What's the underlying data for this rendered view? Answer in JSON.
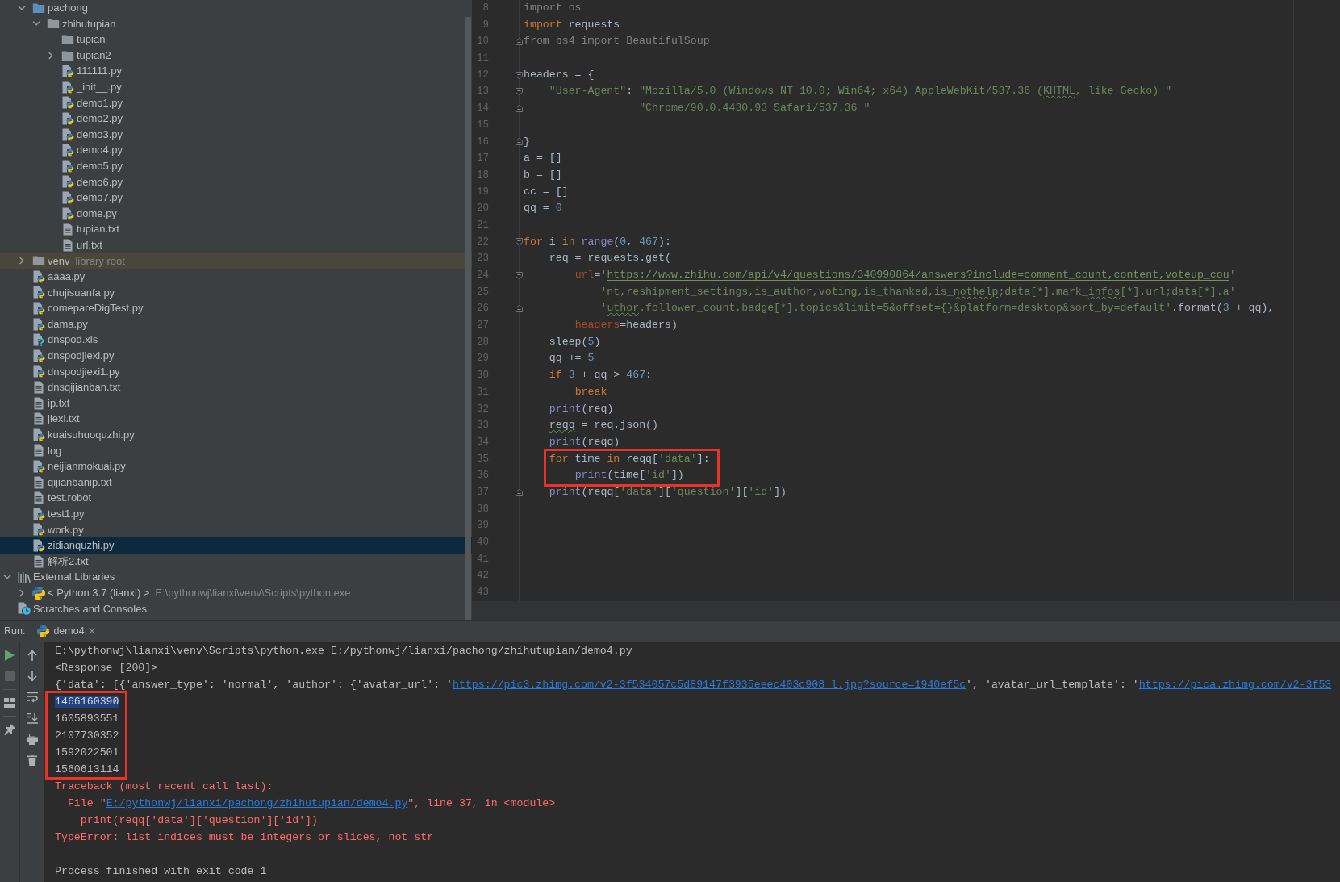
{
  "project_tree": {
    "nodes": [
      {
        "children": [
          {
            "label": "pachong",
            "kind": "package",
            "expanded": true,
            "selected": false,
            "children": [
              {
                "label": "zhihutupian",
                "kind": "folder",
                "expanded": true,
                "selected": false,
                "children": [
                  {
                    "label": "tupian",
                    "kind": "folder",
                    "selected": false
                  },
                  {
                    "label": "tupian2",
                    "kind": "folder",
                    "expanded": false,
                    "selected": false
                  },
                  {
                    "label": "111111.py",
                    "kind": "python",
                    "selected": false
                  },
                  {
                    "label": "_init__.py",
                    "kind": "python",
                    "selected": false
                  },
                  {
                    "label": "demo1.py",
                    "kind": "python",
                    "selected": false
                  },
                  {
                    "label": "demo2.py",
                    "kind": "python",
                    "selected": false
                  },
                  {
                    "label": "demo3.py",
                    "kind": "python",
                    "selected": false
                  },
                  {
                    "label": "demo4.py",
                    "kind": "python",
                    "selected": false
                  },
                  {
                    "label": "demo5.py",
                    "kind": "python",
                    "selected": false
                  },
                  {
                    "label": "demo6.py",
                    "kind": "python",
                    "selected": false
                  },
                  {
                    "label": "demo7.py",
                    "kind": "python",
                    "selected": false
                  },
                  {
                    "label": "dome.py",
                    "kind": "python",
                    "selected": false
                  },
                  {
                    "label": "tupian.txt",
                    "kind": "text",
                    "selected": false
                  },
                  {
                    "label": "url.txt",
                    "kind": "text",
                    "selected": false
                  }
                ]
              }
            ]
          },
          {
            "label": "venv",
            "kind": "folder",
            "expanded": false,
            "detail": "library root",
            "color": "#4a4639",
            "selected": false
          },
          {
            "label": "aaaa.py",
            "kind": "python",
            "selected": false
          },
          {
            "label": "chujisuanfa.py",
            "kind": "python",
            "selected": false
          },
          {
            "label": "comepareDigTest.py",
            "kind": "python",
            "selected": false
          },
          {
            "label": "dama.py",
            "kind": "python",
            "selected": false
          },
          {
            "label": "dnspod.xls",
            "kind": "unknown",
            "selected": false
          },
          {
            "label": "dnspodjiexi.py",
            "kind": "python",
            "selected": false
          },
          {
            "label": "dnspodjiexi1.py",
            "kind": "python",
            "selected": false
          },
          {
            "label": "dnsqijianban.txt",
            "kind": "text",
            "selected": false
          },
          {
            "label": "ip.txt",
            "kind": "text",
            "selected": false
          },
          {
            "label": "jiexi.txt",
            "kind": "text",
            "selected": false
          },
          {
            "label": "kuaisuhuoquzhi.py",
            "kind": "python",
            "selected": false
          },
          {
            "label": "log",
            "kind": "text",
            "selected": false
          },
          {
            "label": "neijianmokuai.py",
            "kind": "python",
            "selected": false
          },
          {
            "label": "qijianbanip.txt",
            "kind": "text",
            "selected": false
          },
          {
            "label": "test.robot",
            "kind": "text",
            "selected": false
          },
          {
            "label": "test1.py",
            "kind": "python",
            "selected": false
          },
          {
            "label": "work.py",
            "kind": "python",
            "selected": false
          },
          {
            "label": "zidianquzhi.py",
            "kind": "python",
            "selected": true
          },
          {
            "label": "解析2.txt",
            "kind": "text",
            "selected": false
          }
        ]
      },
      {
        "label": "External Libraries",
        "kind": "libraries",
        "expanded": true,
        "selected": false,
        "children": [
          {
            "label": "< Python 3.7 (lianxi) >",
            "kind": "interpreter",
            "expanded": false,
            "detail": "E:\\pythonwj\\lianxi\\venv\\Scripts\\python.exe",
            "selected": false
          }
        ]
      },
      {
        "label": "Scratches and Consoles",
        "kind": "scratches",
        "selected": false
      }
    ]
  },
  "editor": {
    "lines": [
      {
        "number": "8",
        "tokens": [
          {
            "kind": "unused",
            "text": "import os"
          }
        ],
        "framed": false
      },
      {
        "number": "9",
        "tokens": [
          {
            "kind": "keyword",
            "text": "import"
          },
          {
            "kind": "plain",
            "text": " requests"
          }
        ],
        "framed": false
      },
      {
        "number": "10",
        "fold": {
          "kind": "end"
        },
        "tokens": [
          {
            "kind": "unused",
            "text": "from bs4 import BeautifulSoup"
          }
        ],
        "framed": false
      },
      {
        "number": "11",
        "framed": false
      },
      {
        "number": "12",
        "fold": {
          "kind": "start"
        },
        "tokens": [
          {
            "kind": "plain",
            "text": "headers = {"
          }
        ],
        "framed": false
      },
      {
        "number": "13",
        "fold": {
          "kind": "start"
        },
        "tokens": [
          {
            "kind": "string",
            "text": "    \"User-Agent\""
          },
          {
            "kind": "plain",
            "text": ": "
          },
          {
            "kind": "string",
            "text": "\"Mozilla/5.0 (Windows NT 10.0; Win64; x64) AppleWebKit/537.36 ("
          },
          {
            "kind": "string-typo",
            "text": "KHTML"
          },
          {
            "kind": "string",
            "text": ", like Gecko) \""
          }
        ],
        "framed": false
      },
      {
        "number": "14",
        "fold": {
          "kind": "end"
        },
        "tokens": [
          {
            "kind": "string",
            "text": "                  \"Chrome/90.0.4430.93 Safari/537.36 \""
          }
        ],
        "framed": false
      },
      {
        "number": "15",
        "framed": false
      },
      {
        "number": "16",
        "fold": {
          "kind": "end"
        },
        "tokens": [
          {
            "kind": "plain",
            "text": "}"
          }
        ],
        "framed": false
      },
      {
        "number": "17",
        "tokens": [
          {
            "kind": "plain",
            "text": "a = []"
          }
        ],
        "framed": false
      },
      {
        "number": "18",
        "tokens": [
          {
            "kind": "plain",
            "text": "b = []"
          }
        ],
        "framed": false
      },
      {
        "number": "19",
        "tokens": [
          {
            "kind": "plain",
            "text": "cc = []"
          }
        ],
        "framed": false
      },
      {
        "number": "20",
        "tokens": [
          {
            "kind": "plain",
            "text": "qq = "
          },
          {
            "kind": "number",
            "text": "0"
          }
        ],
        "framed": false
      },
      {
        "number": "21",
        "framed": false
      },
      {
        "number": "22",
        "fold": {
          "kind": "start"
        },
        "tokens": [
          {
            "kind": "keyword",
            "text": "for"
          },
          {
            "kind": "plain",
            "text": " i "
          },
          {
            "kind": "keyword",
            "text": "in "
          },
          {
            "kind": "builtin",
            "text": "range"
          },
          {
            "kind": "plain",
            "text": "("
          },
          {
            "kind": "number",
            "text": "0"
          },
          {
            "kind": "plain",
            "text": ", "
          },
          {
            "kind": "number",
            "text": "467"
          },
          {
            "kind": "plain",
            "text": "):"
          }
        ],
        "framed": false
      },
      {
        "number": "23",
        "tokens": [
          {
            "kind": "plain",
            "text": "    req = requests.get("
          }
        ],
        "framed": false
      },
      {
        "number": "24",
        "fold": {
          "kind": "start"
        },
        "tokens": [
          {
            "kind": "param",
            "text": "        url"
          },
          {
            "kind": "plain",
            "text": "="
          },
          {
            "kind": "string",
            "text": "'"
          },
          {
            "kind": "link",
            "text": "https://www.zhihu.com/api/v4/questions/340990864/answers?include=comment_count,content,voteup_cou"
          },
          {
            "kind": "string",
            "text": "'"
          }
        ],
        "framed": false
      },
      {
        "number": "25",
        "tokens": [
          {
            "kind": "string",
            "text": "            'nt,reshipment_settings,is_author,voting,is_thanked,is_"
          },
          {
            "kind": "string-typo",
            "text": "nothelp"
          },
          {
            "kind": "string",
            "text": ";data[*].mark_"
          },
          {
            "kind": "string-typo",
            "text": "infos"
          },
          {
            "kind": "string",
            "text": "[*].url;data[*].a'"
          }
        ],
        "framed": false
      },
      {
        "number": "26",
        "fold": {
          "kind": "end"
        },
        "tokens": [
          {
            "kind": "string",
            "text": "            '"
          },
          {
            "kind": "string-typo",
            "text": "uthor"
          },
          {
            "kind": "string",
            "text": ".follower_count,badge[*].topics&limit=5&offset={}&platform=desktop&sort_by=default'"
          },
          {
            "kind": "plain",
            "text": ".format("
          },
          {
            "kind": "number",
            "text": "3"
          },
          {
            "kind": "plain",
            "text": " + qq),"
          }
        ],
        "framed": false
      },
      {
        "number": "27",
        "tokens": [
          {
            "kind": "param",
            "text": "        headers"
          },
          {
            "kind": "plain",
            "text": "=headers)"
          }
        ],
        "framed": false
      },
      {
        "number": "28",
        "tokens": [
          {
            "kind": "plain",
            "text": "    sleep("
          },
          {
            "kind": "number",
            "text": "5"
          },
          {
            "kind": "plain",
            "text": ")"
          }
        ],
        "framed": false
      },
      {
        "number": "29",
        "tokens": [
          {
            "kind": "plain",
            "text": "    qq += "
          },
          {
            "kind": "number",
            "text": "5"
          }
        ],
        "framed": false
      },
      {
        "number": "30",
        "tokens": [
          {
            "kind": "keyword",
            "text": "    if "
          },
          {
            "kind": "number",
            "text": "3"
          },
          {
            "kind": "plain",
            "text": " + qq > "
          },
          {
            "kind": "number",
            "text": "467"
          },
          {
            "kind": "plain",
            "text": ":"
          }
        ],
        "framed": false
      },
      {
        "number": "31",
        "tokens": [
          {
            "kind": "keyword",
            "text": "        break"
          }
        ],
        "framed": false
      },
      {
        "number": "32",
        "tokens": [
          {
            "kind": "builtin",
            "text": "    print"
          },
          {
            "kind": "plain",
            "text": "(req)"
          }
        ],
        "framed": false
      },
      {
        "number": "33",
        "tokens": [
          {
            "kind": "plain-typo",
            "text": "    reqq"
          },
          {
            "kind": "plain",
            "text": " = req.json()"
          }
        ],
        "framed": false
      },
      {
        "number": "34",
        "tokens": [
          {
            "kind": "builtin",
            "text": "    print"
          },
          {
            "kind": "plain",
            "text": "(reqq)"
          }
        ],
        "framed": false
      },
      {
        "number": "35",
        "tokens": [
          {
            "kind": "keyword",
            "text": "    for"
          },
          {
            "kind": "plain",
            "text": " time "
          },
          {
            "kind": "keyword",
            "text": "in"
          },
          {
            "kind": "plain",
            "text": " reqq["
          },
          {
            "kind": "string",
            "text": "'data'"
          },
          {
            "kind": "plain",
            "text": "]:"
          }
        ],
        "framed": true
      },
      {
        "number": "36",
        "tokens": [
          {
            "kind": "builtin",
            "text": "        print"
          },
          {
            "kind": "plain",
            "text": "(time["
          },
          {
            "kind": "string",
            "text": "'id'"
          },
          {
            "kind": "plain",
            "text": "])"
          }
        ],
        "framed": true
      },
      {
        "number": "37",
        "fold": {
          "kind": "end"
        },
        "tokens": [
          {
            "kind": "builtin",
            "text": "    print"
          },
          {
            "kind": "plain",
            "text": "(reqq["
          },
          {
            "kind": "string",
            "text": "'data'"
          },
          {
            "kind": "plain",
            "text": "]["
          },
          {
            "kind": "string",
            "text": "'question'"
          },
          {
            "kind": "plain",
            "text": "]["
          },
          {
            "kind": "string",
            "text": "'id'"
          },
          {
            "kind": "plain",
            "text": "])"
          }
        ],
        "framed": false
      },
      {
        "number": "38",
        "framed": false
      },
      {
        "number": "39",
        "framed": false
      },
      {
        "number": "40",
        "framed": false
      },
      {
        "number": "41",
        "framed": false
      },
      {
        "number": "42",
        "framed": false
      },
      {
        "number": "43",
        "framed": false
      }
    ]
  },
  "run_panel": {
    "label": "Run:",
    "tab": {
      "label": "demo4"
    },
    "toolbar": [
      {
        "kind": "rerun",
        "disabled": false
      },
      {
        "kind": "stop",
        "disabled": true
      },
      {
        "kind": "separator"
      },
      {
        "kind": "layout",
        "disabled": false
      },
      {
        "kind": "separator"
      },
      {
        "kind": "pin",
        "disabled": false
      }
    ],
    "toolbar_2": [
      {
        "kind": "up",
        "disabled": false
      },
      {
        "kind": "down",
        "disabled": false
      },
      {
        "kind": "soft_wrap",
        "disabled": false
      },
      {
        "kind": "scroll_end",
        "disabled": false
      },
      {
        "kind": "print",
        "disabled": false
      },
      {
        "kind": "clear",
        "disabled": false
      }
    ],
    "console": {
      "lines": [
        {
          "kind": "output",
          "segments": [
            {
              "kind": "text",
              "text": "E:\\pythonwj\\lianxi\\venv\\Scripts\\python.exe E:/pythonwj/lianxi/pachong/zhihutupian/demo4.py"
            }
          ],
          "selected": false,
          "framed": false
        },
        {
          "kind": "output",
          "segments": [
            {
              "kind": "text",
              "text": "<Response [200]>"
            }
          ],
          "selected": false,
          "framed": false
        },
        {
          "kind": "output",
          "segments": [
            {
              "kind": "text",
              "text": "{'data': [{'answer_type': 'normal', 'author': {'avatar_url': '"
            },
            {
              "kind": "link",
              "text": "https://pic3.zhimg.com/v2-3f534057c5d89147f3935eeec403c908_l.jpg?source=1940ef5c"
            },
            {
              "kind": "text",
              "text": "', 'avatar_url_template': '"
            },
            {
              "kind": "link",
              "text": "https://pica.zhimg.com/v2-3f53"
            }
          ],
          "selected": false,
          "framed": false
        },
        {
          "kind": "output",
          "segments": [
            {
              "kind": "text",
              "text": "1466160390"
            }
          ],
          "selected": true,
          "framed": true
        },
        {
          "kind": "output",
          "segments": [
            {
              "kind": "text",
              "text": "1605893551"
            }
          ],
          "selected": false,
          "framed": true
        },
        {
          "kind": "output",
          "segments": [
            {
              "kind": "text",
              "text": "2107730352"
            }
          ],
          "selected": false,
          "framed": true
        },
        {
          "kind": "output",
          "segments": [
            {
              "kind": "text",
              "text": "1592022501"
            }
          ],
          "selected": false,
          "framed": true
        },
        {
          "kind": "output",
          "segments": [
            {
              "kind": "text",
              "text": "1560613114"
            }
          ],
          "selected": false,
          "framed": true
        },
        {
          "kind": "error",
          "segments": [
            {
              "kind": "text",
              "text": "Traceback (most recent call last):"
            }
          ],
          "selected": false,
          "framed": false
        },
        {
          "kind": "error",
          "segments": [
            {
              "kind": "text",
              "text": "  File \""
            },
            {
              "kind": "link",
              "text": "E:/pythonwj/lianxi/pachong/zhihutupian/demo4.py"
            },
            {
              "kind": "text",
              "text": "\", line 37, in <module>"
            }
          ],
          "selected": false,
          "framed": false
        },
        {
          "kind": "error",
          "segments": [
            {
              "kind": "text",
              "text": "    print(reqq['data']['question']['id'])"
            }
          ],
          "selected": false,
          "framed": false
        },
        {
          "kind": "error",
          "segments": [
            {
              "kind": "text",
              "text": "TypeError: list indices must be integers or slices, not str"
            }
          ],
          "selected": false,
          "framed": false
        },
        {
          "framed": false
        },
        {
          "kind": "output",
          "segments": [
            {
              "kind": "text",
              "text": "Process finished with exit code 1"
            }
          ],
          "selected": false,
          "framed": false
        }
      ]
    }
  }
}
